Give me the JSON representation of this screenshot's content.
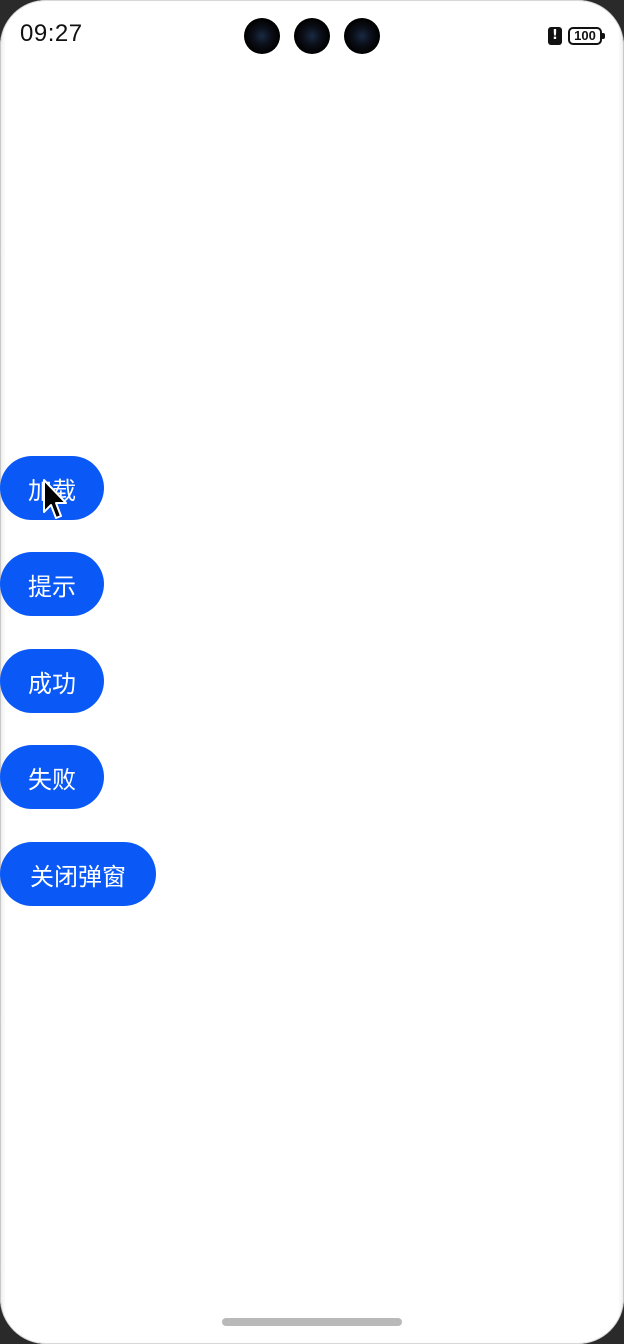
{
  "status_bar": {
    "time": "09:27",
    "battery_level": "100",
    "alert_icon": "battery-alert-icon"
  },
  "buttons": {
    "load": "加载",
    "hint": "提示",
    "success": "成功",
    "fail": "失败",
    "close_dialog": "关闭弹窗"
  },
  "colors": {
    "button_bg": "#0a59f7",
    "button_text": "#ffffff",
    "background": "#ffffff"
  }
}
